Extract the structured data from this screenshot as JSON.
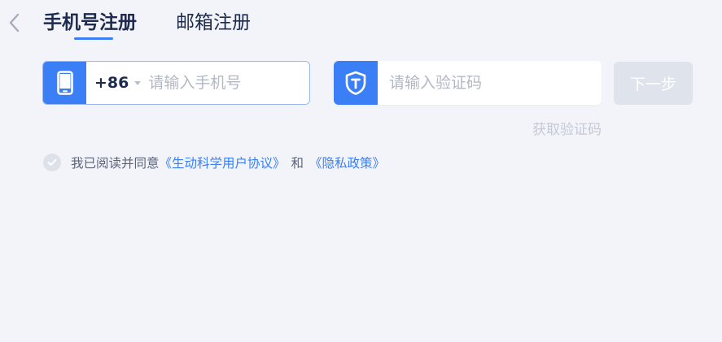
{
  "nav": {
    "back_icon": "chevron-left-icon"
  },
  "tabs": [
    {
      "label": "手机号注册",
      "active": true
    },
    {
      "label": "邮箱注册",
      "active": false
    }
  ],
  "phone_field": {
    "icon": "phone-icon",
    "country_code": "+86",
    "placeholder": "请输入手机号",
    "value": ""
  },
  "code_field": {
    "icon": "shield-t-icon",
    "placeholder": "请输入验证码",
    "value": ""
  },
  "next_button": {
    "label": "下一步",
    "enabled": false
  },
  "get_code_link": {
    "label": "获取验证码"
  },
  "agreement": {
    "prefix": "我已阅读并同意",
    "terms_link": "《生动科学用户协议》",
    "conjunction": "和",
    "privacy_link": "《隐私政策》",
    "checked": false
  },
  "colors": {
    "accent": "#3a7ff6",
    "background": "#f2f4f9",
    "disabled_button": "#dfe3eb",
    "text_dark": "#1d2b50",
    "placeholder": "#b2b8c5"
  }
}
